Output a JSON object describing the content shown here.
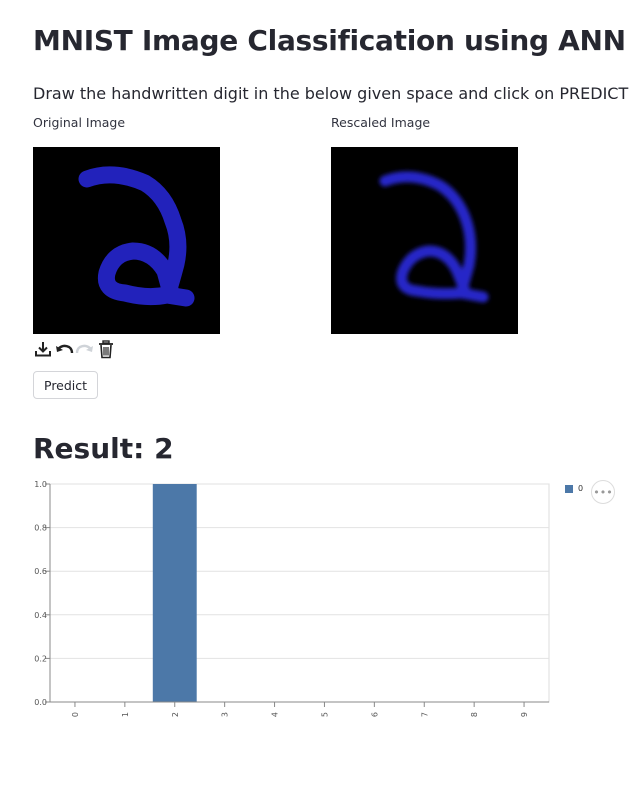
{
  "header": {
    "title": "MNIST Image Classification using ANN",
    "subtitle": "Draw the handwritten digit in the below given space and click on PREDICT"
  },
  "panels": {
    "original_label": "Original Image",
    "rescaled_label": "Rescaled Image"
  },
  "canvas": {
    "background": "#000000",
    "stroke_color": "#2222bb",
    "toolbar": [
      "download-icon",
      "undo-icon",
      "redo-icon",
      "trash-icon"
    ]
  },
  "actions": {
    "predict_label": "Predict"
  },
  "result": {
    "text": "Result: 2"
  },
  "chart_data": {
    "type": "bar",
    "categories": [
      "0",
      "1",
      "2",
      "3",
      "4",
      "5",
      "6",
      "7",
      "8",
      "9"
    ],
    "series": [
      {
        "name": "0",
        "values": [
          0,
          0,
          1.0,
          0,
          0,
          0,
          0,
          0,
          0,
          0
        ]
      }
    ],
    "yticks": [
      "0.0",
      "0.2",
      "0.4",
      "0.6",
      "0.8",
      "1.0"
    ],
    "ylim": [
      0,
      1
    ],
    "grid": true,
    "legend": "top-right",
    "bar_color": "#4c78a8"
  }
}
